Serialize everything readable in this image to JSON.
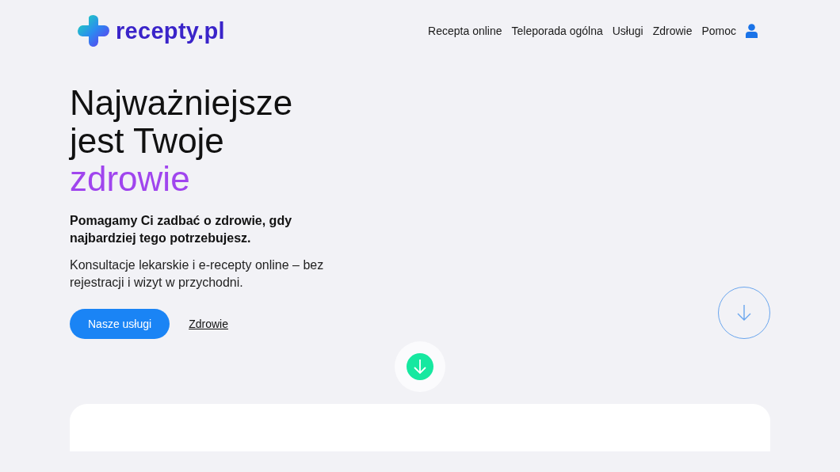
{
  "logo": {
    "text": "recepty.pl"
  },
  "nav": [
    {
      "label": "Recepta online"
    },
    {
      "label": "Teleporada ogólna"
    },
    {
      "label": "Usługi"
    },
    {
      "label": "Zdrowie"
    },
    {
      "label": "Pomoc"
    }
  ],
  "hero": {
    "heading": "Najważniejsze jest Twoje",
    "heading_highlight": "zdrowie",
    "lead": "Pomagamy Ci zadbać o zdrowie, gdy najbardziej tego potrzebujesz.",
    "text": "Konsultacje lekarskie i e-recepty online – bez rejestracji i wizyt w przychodni.",
    "primary_button": "Nasze usługi",
    "link": "Zdrowie"
  }
}
